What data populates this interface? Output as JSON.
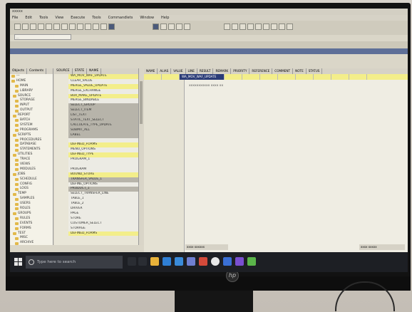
{
  "window": {
    "title": "xxxxx"
  },
  "menu": [
    "File",
    "Edit",
    "Tools",
    "View",
    "Execute",
    "Tools",
    "Commandlets",
    "Window",
    "Help"
  ],
  "search": {
    "value": "...",
    "placeholder": ""
  },
  "tree": {
    "tabs": [
      "Objects",
      "Contents"
    ],
    "items": [
      "---",
      "HOME",
      "MAIN",
      "LIBRARY",
      "SOURCE",
      "STORAGE",
      "INPUT",
      "OUTPUT",
      "REPORT",
      "BATCH",
      "SYSTEM",
      "PROGRAMS",
      "SCRIPTS",
      "PROCEDURES",
      "DATABASE",
      "STATEMENTS",
      "UTILITIES",
      "TRACE",
      "VIEWS",
      "MODULES",
      "JOBS",
      "SCHEDULE",
      "CONFIG",
      "LOGS",
      "TEMP",
      "SAMPLES",
      "USERS",
      "ROLES",
      "GROUPS",
      "RULES",
      "EVENTS",
      "FORMS",
      "TEST",
      "MISC",
      "ARCHIVE"
    ]
  },
  "list": {
    "columns": [
      "SOURCE",
      "STATE",
      "NAME"
    ],
    "rows": [
      {
        "text": "WA_MOV_WAF_UPDATE",
        "style": "yellow"
      },
      {
        "text": "CLEAR_VALUE",
        "style": "plain"
      },
      {
        "text": "MERGE_VALUE_UPDATE",
        "style": "yellow"
      },
      {
        "text": "MERGE_EXCHANGE",
        "style": "plain"
      },
      {
        "text": "BOX_MAKE_UPDATE",
        "style": "yellow"
      },
      {
        "text": "MERGE_BINDABLE",
        "style": "plain"
      },
      {
        "text": "SELECT_GROUP",
        "style": "gray"
      },
      {
        "text": "SELECT_ITEM",
        "style": "gray"
      },
      {
        "text": "LIST_TEXT",
        "style": "gray"
      },
      {
        "text": "STATIC_TEXT_SELECT",
        "style": "gray"
      },
      {
        "text": "CALCULATE_TYPE_UPDATE",
        "style": "gray"
      },
      {
        "text": "SUBMIT_ALL",
        "style": "gray"
      },
      {
        "text": "LABEL",
        "style": "gray"
      },
      {
        "text": "",
        "style": "blank"
      },
      {
        "text": "DEFINED_FORMS",
        "style": "yellow"
      },
      {
        "text": "MENU_OPTIONS",
        "style": "plain"
      },
      {
        "text": "DEFINED_TYPE",
        "style": "yellow"
      },
      {
        "text": "PROGRAM_1",
        "style": "plain"
      },
      {
        "text": "",
        "style": "blank"
      },
      {
        "text": "PROGRAM",
        "style": "plain"
      },
      {
        "text": "BOUND_STORE",
        "style": "yellow"
      },
      {
        "text": "TRANSFER_VALUE_1",
        "style": "gray"
      },
      {
        "text": "DEFINE_OPTIONS",
        "style": "plain"
      },
      {
        "text": "PRODUCT_1",
        "style": "gray"
      },
      {
        "text": "SELECT_TRANSFER_LINE",
        "style": "plain"
      },
      {
        "text": "TABLE_1",
        "style": "plain"
      },
      {
        "text": "TABLE_2",
        "style": "plain"
      },
      {
        "text": "DRIVER",
        "style": "plain"
      },
      {
        "text": "PAGE",
        "style": "plain"
      },
      {
        "text": "STORE",
        "style": "plain"
      },
      {
        "text": "CUSTOMER_SELECT",
        "style": "plain"
      },
      {
        "text": "STORAGE",
        "style": "plain"
      },
      {
        "text": "DEFINED_FORMS",
        "style": "yellow"
      }
    ]
  },
  "grid": {
    "columns": [
      "NAME",
      "ALIAS",
      "VALUE",
      "LINE",
      "RESULT",
      "REMARK",
      "PRIORITY",
      "REFERENCE",
      "COMMENT",
      "NOTE",
      "STATUS"
    ],
    "row": [
      "",
      "",
      "WA_MOV_WAF_UPDATE",
      "",
      "",
      "",
      "",
      "",
      "",
      "",
      ""
    ]
  },
  "editor": {
    "line1": "xxxxxxxxxxx xxxx xx"
  },
  "status": {
    "left": "xxxx xxxxxx",
    "right": "xxxx xxxxx"
  },
  "taskbar": {
    "search_placeholder": "Type here to search",
    "time": "",
    "date": "",
    "icons": [
      "task-view-icon",
      "edge-icon",
      "file-explorer-icon",
      "store-icon",
      "mail-icon",
      "photos-icon",
      "app-red-icon",
      "chrome-icon",
      "app-blue-icon",
      "app-purple-icon",
      "app-green-icon"
    ]
  },
  "colors": {
    "accent": "#2b3c77",
    "highlight": "#f3ee8a",
    "taskbar": "#1d1f24"
  }
}
